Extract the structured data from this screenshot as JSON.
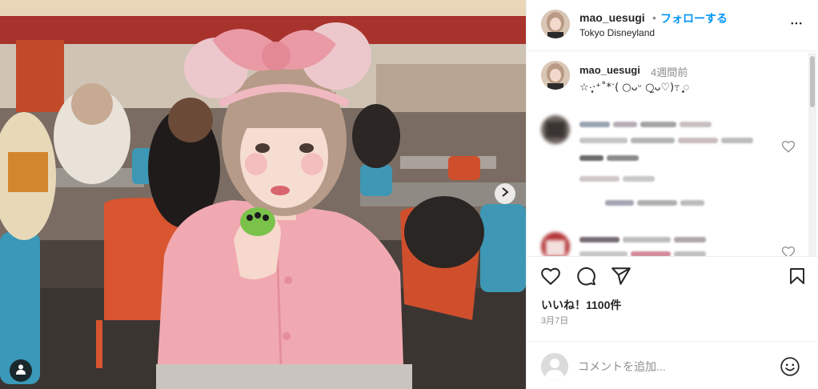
{
  "post": {
    "username": "mao_uesugi",
    "separator": "•",
    "follow_label": "フォローする",
    "location": "Tokyo Disneyland",
    "more_label": "•••"
  },
  "caption": {
    "username": "mao_uesugi",
    "time": "4週間前",
    "text": "☆·͙̥‧⁺˚*ॱ( ○ᴗ︎ᵕ ○̫ᴗ︎♡)߹ ◌͙̥͙"
  },
  "actions": {
    "likes": "いいね！1100件",
    "date": "3月7日"
  },
  "comment_box": {
    "placeholder": "コメントを追加..."
  },
  "colors": {
    "accent": "#0095f6",
    "text": "#262626",
    "muted": "#8e8e8e",
    "border": "#efefef"
  },
  "icons": [
    "more-icon",
    "carousel-next-icon",
    "tagged-user-icon",
    "heart-icon",
    "comment-icon",
    "share-icon",
    "bookmark-icon",
    "emoji-icon"
  ]
}
